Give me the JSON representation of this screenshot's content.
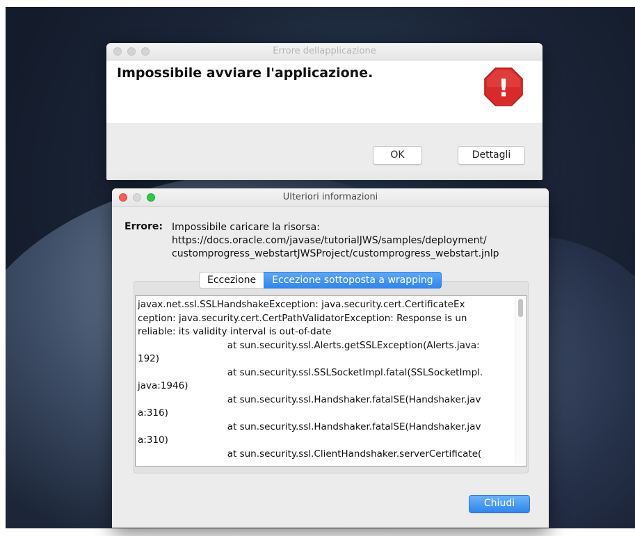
{
  "dialog_error": {
    "title": "Errore dellapplicazione",
    "headline": "Impossibile avviare l'applicazione.",
    "icon": "stop-sign-warning-icon",
    "icon_symbol": "!",
    "colors": {
      "icon_red": "#d82a2a"
    },
    "buttons": {
      "ok": "OK",
      "details": "Dettagli"
    }
  },
  "dialog_details": {
    "title": "Ulteriori informazioni",
    "error_label": "Errore:",
    "error_lines": [
      "Impossibile caricare la risorsa:",
      "https://docs.oracle.com/javase/tutorialJWS/samples/deployment/",
      "customprogress_webstartJWSProject/customprogress_webstart.jnlp"
    ],
    "tabs": [
      {
        "label": "Eccezione",
        "active": false
      },
      {
        "label": "Eccezione sottoposta a wrapping",
        "active": true
      }
    ],
    "stack_trace": [
      "javax.net.ssl.SSLHandshakeException: java.security.cert.CertificateEx",
      "ception: java.security.cert.CertPathValidatorException: Response is un",
      "reliable: its validity interval is out-of-date",
      "                              at sun.security.ssl.Alerts.getSSLException(Alerts.java:",
      "192)",
      "                              at sun.security.ssl.SSLSocketImpl.fatal(SSLSocketImpl.",
      "java:1946)",
      "                              at sun.security.ssl.Handshaker.fatalSE(Handshaker.jav",
      "a:316)",
      "                              at sun.security.ssl.Handshaker.fatalSE(Handshaker.jav",
      "a:310)",
      "                              at sun.security.ssl.ClientHandshaker.serverCertificate("
    ],
    "close_button": "Chiudi",
    "colors": {
      "accent": "#2f86ec"
    }
  }
}
